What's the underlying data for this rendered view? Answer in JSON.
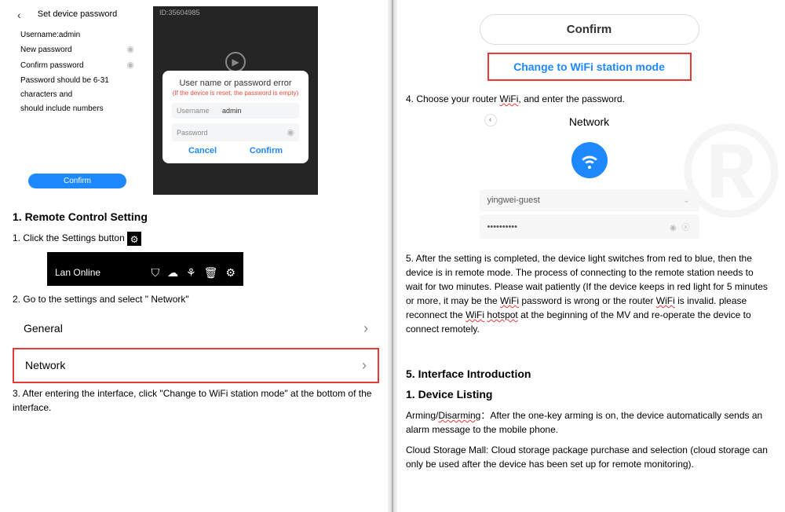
{
  "left": {
    "phone1": {
      "title": "Set device password",
      "lines": [
        "Username:admin",
        "New password",
        "Confirm password",
        "Password should be 6-31 characters and",
        "should include numbers"
      ],
      "confirm": "Confirm"
    },
    "phone2": {
      "id_text": "ID:35604985",
      "dialog_title": "User name or password error",
      "dialog_sub": "(If the device is reset, the password is empty)",
      "username_label": "Username",
      "username_value": "admin",
      "password_label": "Password",
      "cancel": "Cancel",
      "confirm": "Confirm"
    },
    "section1_title": "1. Remote Control Setting",
    "step1": "1. Click the Settings button",
    "toolbar_status": "Lan  Online",
    "step2": "2. Go to the settings    and select \" Network\"",
    "list_general": "General",
    "list_network": "Network",
    "step3": "3.   After entering the interface, click \"Change to WiFi station mode\" at the bottom of the interface."
  },
  "right": {
    "confirm_pill": "Confirm",
    "wifi_mode_btn": "Change to WiFi station mode",
    "step4_prefix": "4.    Choose your router ",
    "step4_wifi": "WiFi",
    "step4_suffix": ", and enter the password.",
    "net_title": "Network",
    "ssid": "yingwei-guest",
    "password_dots": "••••••••••",
    "step5_a": "5. After the setting is completed, the device light switches from red to blue, then the device is in remote mode. The process of connecting to the remote station needs to wait for two minutes. Please wait patiently (If the device keeps in red light for 5 minutes or more, it may be the ",
    "wifi_word": "WiFi",
    "step5_b": " password is wrong or the router ",
    "step5_c": " is invalid. please reconnect the ",
    "hotspot": "hotspot",
    "step5_d": " at the beginning of the MV and re-operate the device to connect remotely.",
    "section5_title": "5. Interface Introduction",
    "device_listing": "1. Device Listing",
    "arming_prefix": "Arming/",
    "disarming": "Disarming",
    "arming_body": "：After the one-key arming is on, the device automatically sends an alarm message to the mobile phone.",
    "cloud_body": "Cloud Storage Mall: Cloud storage package purchase and selection (cloud storage can only be used after the device has been set up for remote monitoring)."
  }
}
